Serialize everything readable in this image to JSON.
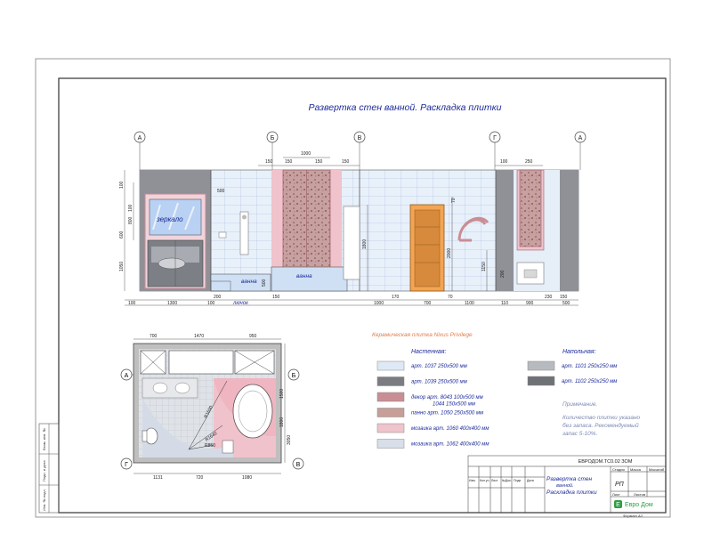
{
  "title": "Развертка стен ванной. Раскладка плитки",
  "axis_markers": [
    "А",
    "Б",
    "В",
    "Г",
    "А"
  ],
  "plan_markers": {
    "top_left": "А",
    "top_right": "Б",
    "bottom_left": "Г",
    "bottom_right": "В"
  },
  "elevation_labels": {
    "mirror": "зеркало",
    "bath1": "ванна",
    "bath2": "ванна",
    "hatch": "лючок"
  },
  "top_dims": [
    "150",
    "1000",
    "150",
    "150",
    "150",
    "100",
    "250"
  ],
  "left_dims": [
    "100",
    "100",
    "800",
    "600",
    "1050"
  ],
  "mid_dims": [
    "500",
    "1800",
    "500",
    "70",
    "2000",
    "1150",
    "200"
  ],
  "bottom_dims": [
    "100",
    "1300",
    "200",
    "100",
    "150",
    "1000",
    "170",
    "700",
    "70",
    "1100",
    "110",
    "900",
    "230",
    "500",
    "150"
  ],
  "plan_top_dims": [
    "700",
    "1470",
    "950"
  ],
  "plan_bottom_dims": [
    "1131",
    "720",
    "1080"
  ],
  "plan_side_dims": [
    "1500",
    "1800",
    "3050"
  ],
  "plan_radii": [
    "R1600",
    "R1640",
    "R850"
  ],
  "legend": {
    "header": "Керамическая плитка Nixus Privilege",
    "wall_title": "Настенная:",
    "floor_title": "Напольная:",
    "wall_items": [
      {
        "text": "арт. 1037 250x500 мм",
        "color": "#dfe9f6"
      },
      {
        "text": "арт. 1039 250x500 мм",
        "color": "#7a7c82"
      },
      {
        "text": "декор арт. 8043 100x500 мм",
        "color": "#c98e94"
      },
      {
        "text": "1044 150x500 мм",
        "color": ""
      },
      {
        "text": "панно арт. 1050 250x500 мм",
        "color": "#c79e98"
      },
      {
        "text": "мозаика арт. 1060 400x400 мм",
        "color": "#efc4cc"
      },
      {
        "text": "мозаика арт. 1062 400x400 мм",
        "color": "#d8dfe9"
      }
    ],
    "floor_items": [
      {
        "text": "арт. 1101 250x250 мм",
        "color": "#b7bbbf"
      },
      {
        "text": "арт. 1102 250x250 мм",
        "color": "#6e7176"
      }
    ],
    "note_title": "Примечание.",
    "note_lines": [
      "Количество плитки указано",
      "без запаса. Рекомендуемый",
      "запас 5-10%."
    ]
  },
  "stamp": {
    "code": "ЕВРОДОМ.ТС0.02 ЗОМ",
    "name_lines": [
      "Развертка стен",
      "ванной.",
      "Раскладка плитки"
    ],
    "col_heads": [
      "Стадия",
      "Масса",
      "Масштаб"
    ],
    "stage": "РП",
    "sheet_row": [
      "Лист",
      "Листов"
    ],
    "left_heads": [
      "Изм.",
      "Кол.уч",
      "Лист",
      "№Док.",
      "Подп.",
      "Дата"
    ],
    "company": "Евро Дом",
    "format": "Формат А3"
  },
  "side_stamp": [
    "Взам. инв. №",
    "Подп. и дата",
    "Инв. № подл."
  ]
}
